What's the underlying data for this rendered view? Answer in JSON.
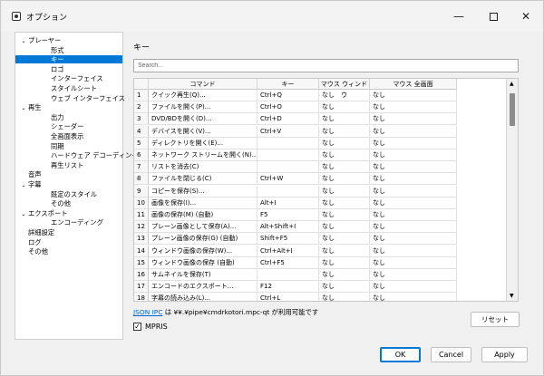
{
  "window": {
    "title": "オプション"
  },
  "sidebar": {
    "items": [
      {
        "label": "プレーヤー",
        "arrow": "⌄",
        "level": 0
      },
      {
        "label": "形式",
        "arrow": "",
        "level": 1
      },
      {
        "label": "キー",
        "arrow": "",
        "level": 1,
        "selected": true
      },
      {
        "label": "ロゴ",
        "arrow": "",
        "level": 1
      },
      {
        "label": "インターフェイス",
        "arrow": "",
        "level": 1
      },
      {
        "label": "スタイルシート",
        "arrow": "",
        "level": 1
      },
      {
        "label": "ウェブ インターフェイス",
        "arrow": "",
        "level": 1
      },
      {
        "label": "再生",
        "arrow": "⌄",
        "level": 0
      },
      {
        "label": "出力",
        "arrow": "",
        "level": 1
      },
      {
        "label": "シェーダー",
        "arrow": "",
        "level": 1
      },
      {
        "label": "全画面表示",
        "arrow": "",
        "level": 1
      },
      {
        "label": "同期",
        "arrow": "",
        "level": 1
      },
      {
        "label": "ハードウェア デコーディング",
        "arrow": "",
        "level": 1
      },
      {
        "label": "再生リスト",
        "arrow": "",
        "level": 1
      },
      {
        "label": "音声",
        "arrow": "",
        "level": 0
      },
      {
        "label": "字幕",
        "arrow": "⌄",
        "level": 0
      },
      {
        "label": "既定のスタイル",
        "arrow": "",
        "level": 1
      },
      {
        "label": "その他",
        "arrow": "",
        "level": 1
      },
      {
        "label": "エクスポート",
        "arrow": "⌄",
        "level": 0
      },
      {
        "label": "エンコーディング",
        "arrow": "",
        "level": 1
      },
      {
        "label": "詳細設定",
        "arrow": "",
        "level": 0
      },
      {
        "label": "ログ",
        "arrow": "",
        "level": 0
      },
      {
        "label": "その他",
        "arrow": "",
        "level": 0
      }
    ]
  },
  "page": {
    "title": "キー",
    "search_placeholder": "Search..."
  },
  "table": {
    "headers": [
      "コマンド",
      "キー",
      "マウス ウィンドウ",
      "マウス 全画面"
    ],
    "rows": [
      [
        "1",
        "クイック再生(Q)...",
        "Ctrl+Q",
        "なし",
        "なし"
      ],
      [
        "2",
        "ファイルを開く(P)...",
        "Ctrl+O",
        "なし",
        "なし"
      ],
      [
        "3",
        "DVD/BDを開く(D)...",
        "Ctrl+D",
        "なし",
        "なし"
      ],
      [
        "4",
        "デバイスを開く(V)...",
        "Ctrl+V",
        "なし",
        "なし"
      ],
      [
        "5",
        "ディレクトリを開く(E)...",
        "",
        "なし",
        "なし"
      ],
      [
        "6",
        "ネットワーク ストリームを開く(N)...",
        "",
        "なし",
        "なし"
      ],
      [
        "7",
        "リストを消去(C)",
        "",
        "なし",
        "なし"
      ],
      [
        "8",
        "ファイルを閉じる(C)",
        "Ctrl+W",
        "なし",
        "なし"
      ],
      [
        "9",
        "コピーを保存(S)...",
        "",
        "なし",
        "なし"
      ],
      [
        "10",
        "画像を保存(I)...",
        "Alt+I",
        "なし",
        "なし"
      ],
      [
        "11",
        "画像の保存(M) (自動)",
        "F5",
        "なし",
        "なし"
      ],
      [
        "12",
        "プレーン画像として保存(A)...",
        "Alt+Shift+I",
        "なし",
        "なし"
      ],
      [
        "13",
        "プレーン画像の保存(G) (自動)",
        "Shift+F5",
        "なし",
        "なし"
      ],
      [
        "14",
        "ウィンドウ画像の保存(W)...",
        "Ctrl+Alt+I",
        "なし",
        "なし"
      ],
      [
        "15",
        "ウィンドウ画像の保存 (自動)",
        "Ctrl+F5",
        "なし",
        "なし"
      ],
      [
        "16",
        "サムネイルを保存(T)",
        "",
        "なし",
        "なし"
      ],
      [
        "17",
        "エンコードのエクスポート...",
        "F12",
        "なし",
        "なし"
      ],
      [
        "18",
        "字幕の読み込み(L)...",
        "Ctrl+L",
        "なし",
        "なし"
      ]
    ]
  },
  "footer": {
    "json_ipc_link": "JSON IPC",
    "json_ipc_text": " は ¥¥.¥pipe¥cmdrkotori.mpc-qt が利用可能です",
    "reset_label": "リセット",
    "mpris_label": "MPRIS",
    "mpris_checked": "✓"
  },
  "buttons": {
    "ok": "OK",
    "cancel": "Cancel",
    "apply": "Apply"
  }
}
